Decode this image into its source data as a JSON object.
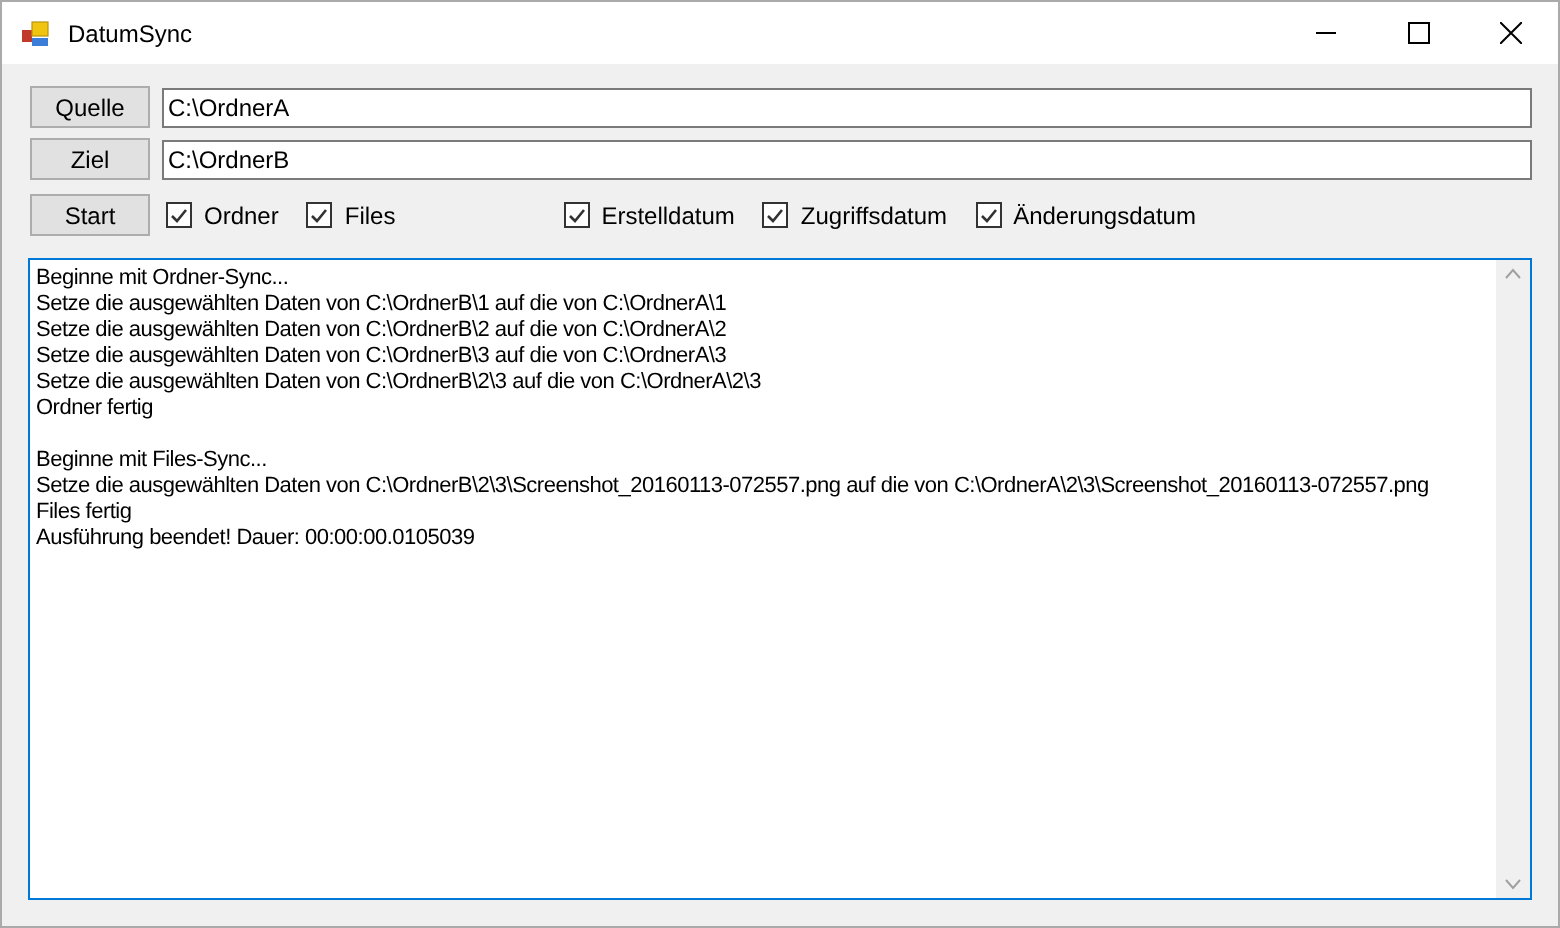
{
  "window": {
    "title": "DatumSync"
  },
  "paths": [
    {
      "button": "Quelle",
      "value": "C:\\OrdnerA"
    },
    {
      "button": "Ziel",
      "value": "C:\\OrdnerB"
    }
  ],
  "start_button": "Start",
  "sync_targets": [
    {
      "label": "Ordner",
      "checked": true
    },
    {
      "label": "Files",
      "checked": true
    }
  ],
  "date_fields": [
    {
      "label": "Erstelldatum",
      "checked": true
    },
    {
      "label": "Zugriffsdatum",
      "checked": true
    },
    {
      "label": "Änderungsdatum",
      "checked": true
    }
  ],
  "log": [
    {
      "lines": [
        "Beginne mit Ordner-Sync...",
        "Setze die ausgewählten Daten von C:\\OrdnerB\\1 auf die von C:\\OrdnerA\\1",
        "Setze die ausgewählten Daten von C:\\OrdnerB\\2 auf die von C:\\OrdnerA\\2",
        "Setze die ausgewählten Daten von C:\\OrdnerB\\3 auf die von C:\\OrdnerA\\3",
        "Setze die ausgewählten Daten von C:\\OrdnerB\\2\\3 auf die von C:\\OrdnerA\\2\\3",
        "Ordner fertig"
      ]
    },
    {
      "lines": [
        "Beginne mit Files-Sync...",
        "Setze die ausgewählten Daten von C:\\OrdnerB\\2\\3\\Screenshot_20160113-072557.png auf die von C:\\OrdnerA\\2\\3\\Screenshot_20160113-072557.png",
        "Files fertig",
        "Ausführung beendet! Dauer: 00:00:00.0105039"
      ]
    }
  ]
}
